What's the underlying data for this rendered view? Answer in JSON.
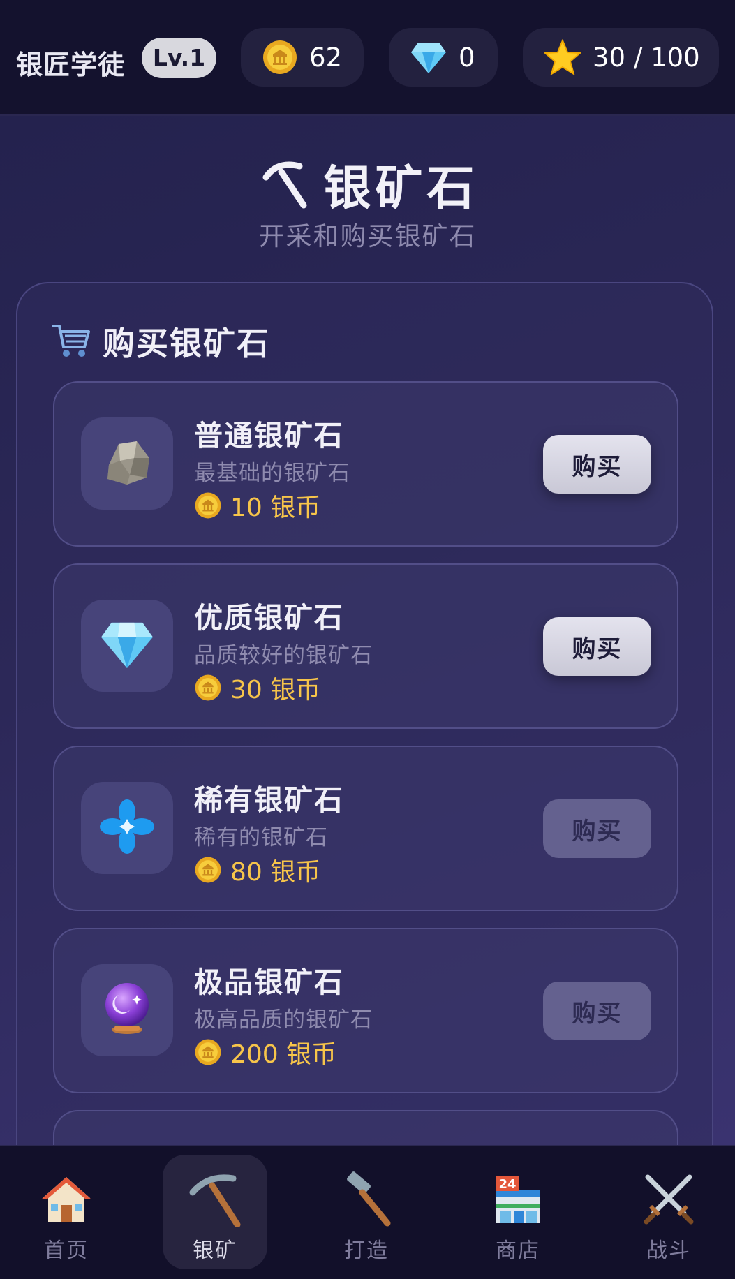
{
  "header": {
    "player_title": "银匠学徒",
    "level": "Lv.1",
    "coins": "62",
    "gems": "0",
    "stars": "30 / 100"
  },
  "page": {
    "icon": "pickaxe-icon",
    "title": "银矿石",
    "subtitle": "开采和购买银矿石"
  },
  "shop": {
    "section_icon": "cart-icon",
    "section_title": "购买银矿石",
    "items": [
      {
        "name": "普通银矿石",
        "desc": "最基础的银矿石",
        "price": "10 银币",
        "icon": "rock-icon",
        "button": "购买",
        "enabled": true
      },
      {
        "name": "优质银矿石",
        "desc": "品质较好的银矿石",
        "price": "30 银币",
        "icon": "diamond-icon",
        "button": "购买",
        "enabled": true
      },
      {
        "name": "稀有银矿石",
        "desc": "稀有的银矿石",
        "price": "80 银币",
        "icon": "blue-star-icon",
        "button": "购买",
        "enabled": false
      },
      {
        "name": "极品银矿石",
        "desc": "极高品质的银矿石",
        "price": "200 银币",
        "icon": "crystal-ball-icon",
        "button": "购买",
        "enabled": false
      }
    ]
  },
  "nav": {
    "items": [
      {
        "label": "首页",
        "icon": "house-icon"
      },
      {
        "label": "银矿",
        "icon": "pickaxe-icon",
        "active": true
      },
      {
        "label": "打造",
        "icon": "hammer-icon"
      },
      {
        "label": "商店",
        "icon": "store-icon"
      },
      {
        "label": "战斗",
        "icon": "crossed-swords-icon"
      }
    ]
  },
  "colors": {
    "accent_gold": "#f7c54a",
    "background": "#161433",
    "panel": "#2c2858"
  }
}
